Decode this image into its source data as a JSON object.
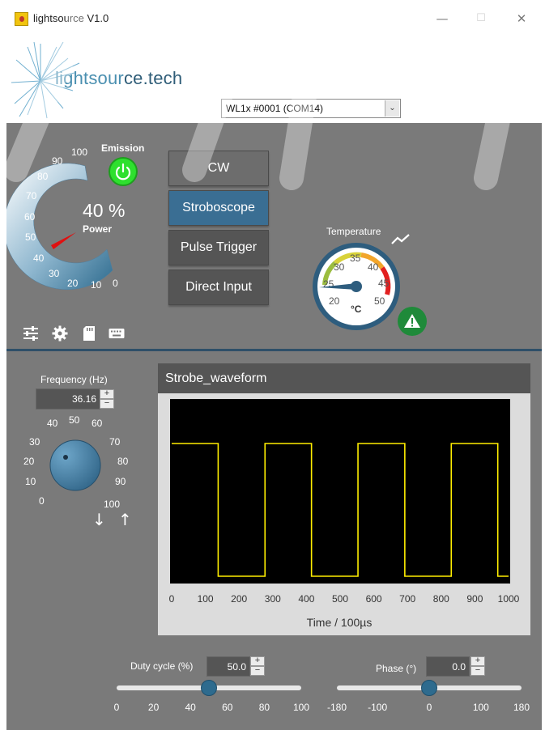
{
  "window": {
    "title": "lightsource V1.0",
    "minimize": "—",
    "maximize": "☐",
    "close": "✕"
  },
  "header": {
    "logo_light": "lightsour",
    "logo_dark": "ce.tech",
    "device": "WL1x #0001 (COM14)"
  },
  "power": {
    "emission_label": "Emission",
    "value_label": "40 %",
    "label": "Power",
    "percent": 40,
    "scale": [
      "100",
      "90",
      "80",
      "70",
      "60",
      "50",
      "40",
      "30",
      "20",
      "10",
      "0"
    ]
  },
  "modes": [
    {
      "label": "CW",
      "active": false
    },
    {
      "label": "Stroboscope",
      "active": true
    },
    {
      "label": "Pulse Trigger",
      "active": false
    },
    {
      "label": "Direct Input",
      "active": false
    }
  ],
  "toolbar": {
    "icons": [
      "sliders-icon",
      "gear-icon",
      "sd-card-icon",
      "keyboard-icon"
    ]
  },
  "temperature": {
    "label": "Temperature",
    "unit": "°C",
    "value": 25,
    "scale": [
      "20",
      "25",
      "30",
      "35",
      "40",
      "45",
      "50"
    ]
  },
  "frequency": {
    "label": "Frequency (Hz)",
    "value": "36.16",
    "scale": [
      "0",
      "10",
      "20",
      "30",
      "40",
      "50",
      "60",
      "70",
      "80",
      "90",
      "100"
    ],
    "down": "↓",
    "up": "↑"
  },
  "chart": {
    "title": "Strobe_waveform",
    "xlabel": "Time / 100µs"
  },
  "chart_data": {
    "type": "line",
    "title": "Strobe_waveform",
    "xlabel": "Time / 100µs",
    "ylabel": "",
    "xlim": [
      0,
      1000
    ],
    "ylim": [
      0,
      1
    ],
    "x_ticks": [
      "0",
      "100",
      "200",
      "300",
      "400",
      "500",
      "600",
      "700",
      "800",
      "900",
      "1000"
    ],
    "grid": false,
    "series": [
      {
        "color": "#ffee00",
        "x": [
          0,
          138,
          138,
          277,
          277,
          415,
          415,
          553,
          553,
          692,
          692,
          830,
          830,
          968,
          968,
          1000
        ],
        "y": [
          1,
          1,
          0,
          0,
          1,
          1,
          0,
          0,
          1,
          1,
          0,
          0,
          1,
          1,
          0,
          0
        ]
      }
    ]
  },
  "duty_cycle": {
    "label": "Duty cycle (%)",
    "value": "50.0",
    "level": 50,
    "ticks": [
      "0",
      "20",
      "40",
      "60",
      "80",
      "100"
    ]
  },
  "phase": {
    "label": "Phase (°)",
    "value": "0.0",
    "level": 0,
    "ticks": [
      "-180",
      "-100",
      "0",
      "100",
      "180"
    ]
  },
  "spin": {
    "plus": "+",
    "minus": "−"
  },
  "colors": {
    "panel": "#7a7a7a",
    "accent": "#3a6e93",
    "emission_on": "#2ee02e",
    "waveform": "#ffee00"
  }
}
